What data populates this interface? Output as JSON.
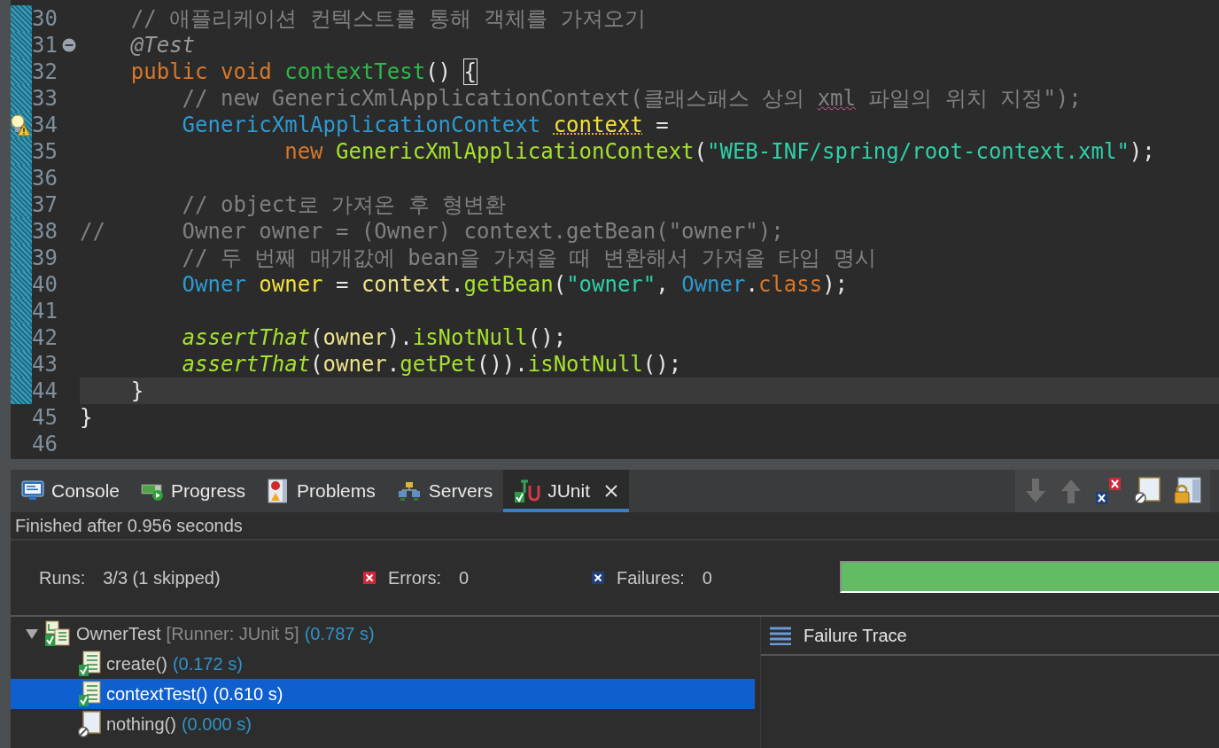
{
  "editor": {
    "lines": [
      {
        "number": "30",
        "kind": "code",
        "changed": true,
        "current": false,
        "tokens": [
          {
            "kind": "comment",
            "text": "    // 애플리케이션 컨텍스트를 통해 객체를 가져오기"
          }
        ]
      },
      {
        "number": "31",
        "kind": "fold",
        "changed": true,
        "current": false,
        "tokens": [
          {
            "kind": "annotation",
            "text": "    @Test"
          }
        ]
      },
      {
        "number": "32",
        "kind": "code",
        "changed": true,
        "current": false,
        "tokens": [
          {
            "kind": "keyword",
            "text": "    public void "
          },
          {
            "kind": "method-decl",
            "text": "contextTest"
          },
          {
            "kind": "plain",
            "text": "() "
          },
          {
            "kind": "brace-match",
            "text": "{"
          }
        ]
      },
      {
        "number": "33",
        "kind": "code",
        "changed": true,
        "current": false,
        "tokens": [
          {
            "kind": "comment",
            "text": "        // new GenericXmlApplicationContext(클래스패스 상의 "
          },
          {
            "kind": "comment-spell",
            "text": "xml"
          },
          {
            "kind": "comment",
            "text": " 파일의 위치 지정\");"
          }
        ]
      },
      {
        "number": "34",
        "kind": "warning",
        "changed": true,
        "current": false,
        "tokens": [
          {
            "kind": "type",
            "text": "        GenericXmlApplicationContext "
          },
          {
            "kind": "var-warn",
            "text": "context"
          },
          {
            "kind": "plain",
            "text": " ="
          }
        ]
      },
      {
        "number": "35",
        "kind": "code",
        "changed": true,
        "current": false,
        "tokens": [
          {
            "kind": "keyword",
            "text": "                new "
          },
          {
            "kind": "constructor",
            "text": "GenericXmlApplicationContext"
          },
          {
            "kind": "plain",
            "text": "("
          },
          {
            "kind": "string",
            "text": "\"WEB-INF/spring/root-context.xml\""
          },
          {
            "kind": "plain",
            "text": ");"
          }
        ]
      },
      {
        "number": "36",
        "kind": "code",
        "changed": true,
        "current": false
      },
      {
        "number": "37",
        "kind": "code",
        "changed": true,
        "current": false,
        "tokens": [
          {
            "kind": "comment",
            "text": "        // object로 가져온 후 형변환"
          }
        ]
      },
      {
        "number": "38",
        "kind": "code",
        "changed": true,
        "current": false,
        "tokens": [
          {
            "kind": "comment",
            "text": "//      Owner owner = (Owner) context.getBean(\"owner\");"
          }
        ]
      },
      {
        "number": "39",
        "kind": "code",
        "changed": true,
        "current": false,
        "tokens": [
          {
            "kind": "comment",
            "text": "        // 두 번째 매개값에 bean을 가져올 때 변환해서 가져올 타입 명시"
          }
        ]
      },
      {
        "number": "40",
        "kind": "code",
        "changed": true,
        "current": false,
        "tokens": [
          {
            "kind": "type",
            "text": "        Owner "
          },
          {
            "kind": "var-decl",
            "text": "owner"
          },
          {
            "kind": "plain",
            "text": " = "
          },
          {
            "kind": "var",
            "text": "context"
          },
          {
            "kind": "plain",
            "text": "."
          },
          {
            "kind": "method",
            "text": "getBean"
          },
          {
            "kind": "plain",
            "text": "("
          },
          {
            "kind": "string",
            "text": "\"owner\""
          },
          {
            "kind": "plain",
            "text": ", "
          },
          {
            "kind": "type",
            "text": "Owner"
          },
          {
            "kind": "plain",
            "text": "."
          },
          {
            "kind": "keyword",
            "text": "class"
          },
          {
            "kind": "plain",
            "text": ");"
          }
        ]
      },
      {
        "number": "41",
        "kind": "code",
        "changed": true,
        "current": false
      },
      {
        "number": "42",
        "kind": "code",
        "changed": true,
        "current": false,
        "tokens": [
          {
            "kind": "static",
            "text": "        assertThat"
          },
          {
            "kind": "plain",
            "text": "("
          },
          {
            "kind": "var",
            "text": "owner"
          },
          {
            "kind": "plain",
            "text": ")."
          },
          {
            "kind": "method",
            "text": "isNotNull"
          },
          {
            "kind": "plain",
            "text": "();"
          }
        ]
      },
      {
        "number": "43",
        "kind": "code",
        "changed": true,
        "current": false,
        "tokens": [
          {
            "kind": "static",
            "text": "        assertThat"
          },
          {
            "kind": "plain",
            "text": "("
          },
          {
            "kind": "var",
            "text": "owner"
          },
          {
            "kind": "plain",
            "text": "."
          },
          {
            "kind": "method",
            "text": "getPet"
          },
          {
            "kind": "plain",
            "text": "())."
          },
          {
            "kind": "method",
            "text": "isNotNull"
          },
          {
            "kind": "plain",
            "text": "();"
          }
        ]
      },
      {
        "number": "44",
        "kind": "code",
        "changed": true,
        "current": true,
        "tokens": [
          {
            "kind": "plain",
            "text": "    }"
          }
        ]
      },
      {
        "number": "45",
        "kind": "code",
        "changed": false,
        "current": false,
        "tokens": [
          {
            "kind": "plain",
            "text": "}"
          }
        ]
      },
      {
        "number": "46",
        "kind": "code",
        "changed": false,
        "current": false
      }
    ]
  },
  "panel": {
    "tabs": [
      {
        "label": "Console",
        "selected": false
      },
      {
        "label": "Progress",
        "selected": false
      },
      {
        "label": "Problems",
        "selected": false
      },
      {
        "label": "Servers",
        "selected": false
      },
      {
        "label": "JUnit",
        "selected": true
      }
    ],
    "status": "Finished after 0.956 seconds",
    "counters": {
      "runs_label": "Runs:",
      "runs": "3/3 (1 skipped)",
      "errors_label": "Errors:",
      "errors": "0",
      "failures_label": "Failures:",
      "failures": "0"
    },
    "progress": {
      "level": 1
    },
    "tree": [
      {
        "kind": "suite",
        "name": "OwnerTest",
        "detail": "[Runner: JUnit 5]",
        "time": "(0.787 s)",
        "expanded": true,
        "selected": false,
        "children": [
          {
            "kind": "passed",
            "name": "create()",
            "time": "(0.172 s)",
            "selected": false
          },
          {
            "kind": "passed",
            "name": "contextTest()",
            "time": "(0.610 s)",
            "selected": true
          },
          {
            "kind": "skipped",
            "name": "nothing()",
            "time": "(0.000 s)",
            "selected": false
          }
        ]
      }
    ],
    "failure_trace": {
      "title": "Failure Trace"
    }
  }
}
